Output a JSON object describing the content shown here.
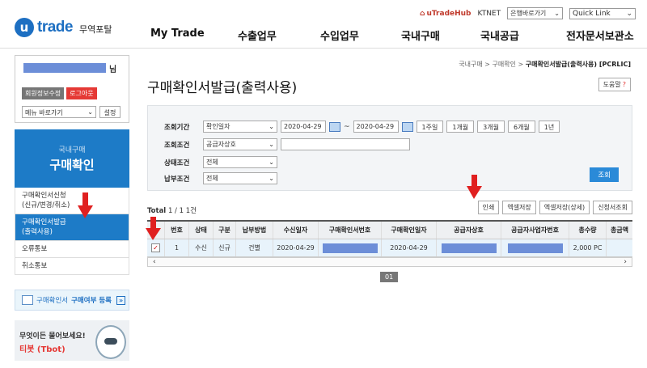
{
  "header": {
    "logo_u": "u",
    "logo_trade": "trade",
    "logo_sub": "무역포탈",
    "util": {
      "hub": "uTradeHub",
      "ktnet": "KTNET",
      "bank_select": "은행바로가기",
      "quick_link": "Quick Link"
    },
    "nav": [
      "My Trade",
      "수출업무",
      "수입업무",
      "국내구매",
      "국내공급",
      "전자문서보관소"
    ]
  },
  "sidebar": {
    "user_suffix": "님",
    "btn_edit_info": "회원정보수정",
    "btn_logout": "로그아웃",
    "menu_select": "메뉴 바로가기",
    "btn_settings": "설정",
    "category_small": "국내구매",
    "category_big": "구매확인",
    "items": [
      {
        "label": "구매확인서신청\n(신규/변경/취소)"
      },
      {
        "label": "구매확인서발급\n(출력사용)"
      },
      {
        "label": "오류통보"
      },
      {
        "label": "취소통보"
      }
    ],
    "banner1_label": "구매확인서",
    "banner1_bold": "구매여부 등록",
    "banner1_arrow": "»",
    "banner2_line1": "무엇이든 물어보세요!",
    "banner2_line2": "티봇 (Tbot)"
  },
  "main": {
    "breadcrumb": [
      "국내구매",
      "구매확인",
      "구매확인서발급(출력사용) [PCRLIC]"
    ],
    "breadcrumb_sep": ">",
    "title": "구매확인서발급(출력사용)",
    "help": "도움말",
    "help_mark": "?",
    "search": {
      "period_label": "조회기간",
      "period_select": "확인일자",
      "date_from": "2020-04-29",
      "date_sep": "~",
      "date_to": "2020-04-29",
      "period_buttons": [
        "1주일",
        "1개월",
        "3개월",
        "6개월",
        "1년"
      ],
      "cond_label": "조회조건",
      "cond_select": "공급자상호",
      "cond_value": "",
      "status_label": "상태조건",
      "status_select": "전체",
      "pay_label": "납부조건",
      "pay_select": "전체",
      "search_button": "조회"
    },
    "total_text": "Total",
    "total_value": "1 / 1",
    "total_count": "1건",
    "action_buttons": [
      "인쇄",
      "엑셀저장",
      "엑셀저장(상세)",
      "신청서조회"
    ],
    "table": {
      "headers": [
        "",
        "번호",
        "상태",
        "구분",
        "납부방법",
        "수신일자",
        "구매확인서번호",
        "구매확인일자",
        "공급자상호",
        "공급자사업자번호",
        "총수량",
        "총금액"
      ],
      "rows": [
        [
          "✓",
          "1",
          "수신",
          "신규",
          "건별",
          "2020-04-29",
          "",
          "2020-04-29",
          "",
          "",
          "2,000 PC",
          ""
        ]
      ]
    },
    "page": "01"
  },
  "colors": {
    "brand": "#1d6fc2",
    "accent_red": "#e53935",
    "arrow_red": "#e02020"
  }
}
